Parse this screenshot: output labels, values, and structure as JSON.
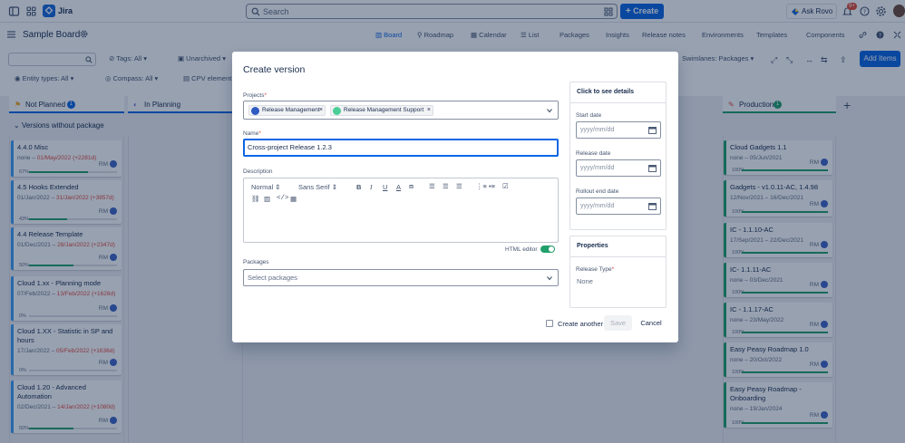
{
  "topnav": {
    "app_name": "Jira",
    "search_placeholder": "Search",
    "create_label": "Create",
    "ask_rovo_label": "Ask Rovo",
    "notifications_badge": "9+"
  },
  "board": {
    "title": "Sample Board",
    "tabs": [
      "Board",
      "Roadmap",
      "Calendar",
      "List",
      "Packages",
      "Insights",
      "Release notes",
      "Environments",
      "Templates",
      "Components"
    ],
    "active_tab": "Board"
  },
  "filters": {
    "tags": "Tags: All",
    "unarchived": "Unarchived",
    "entity_types": "Entity types: All",
    "compass": "Compass: All",
    "cpv": "CPV element",
    "swimlanes": "Swimlanes: Packages",
    "add_items": "Add Items"
  },
  "columns": {
    "not_planned": "Not Planned",
    "in_planning": "In Planning",
    "production": "Production",
    "not_planned_count": "1",
    "production_count": "1"
  },
  "swimlane_label": "Versions without package",
  "left_cards": [
    {
      "title": "4.4.0 Misc",
      "dates": "none – ",
      "late_date": "01/May/2022",
      "late": "(+2281d)",
      "pct": "67%",
      "fill": 0.67,
      "owner": "RM"
    },
    {
      "title": "4.5 Hooks Extended",
      "dates": "01/Jan/2022 – ",
      "late_date": "31/Jan/2022",
      "late": "(+3857d)",
      "pct": "43%",
      "fill": 0.43,
      "owner": "RM"
    },
    {
      "title": "4.4 Release Template",
      "dates": "01/Dec/2021 – ",
      "late_date": "28/Jan/2022",
      "late": "(+2347d)",
      "pct": "50%",
      "fill": 0.5,
      "owner": "RM"
    },
    {
      "title": "Cloud 1.xx - Planning mode",
      "dates": "07/Feb/2022 – ",
      "late_date": "13/Feb/2022",
      "late": "(+1628d)",
      "pct": "0%",
      "fill": 0.0,
      "owner": "RM"
    },
    {
      "title": "Cloud 1.XX - Statistic in SP and hours",
      "dates": "17/Jan/2022 – ",
      "late_date": "05/Feb/2022",
      "late": "(+1636d)",
      "pct": "0%",
      "fill": 0.0,
      "owner": "RM"
    },
    {
      "title": "Cloud 1.20 - Advanced Automation",
      "dates": "02/Dec/2021 – ",
      "late_date": "14/Jan/2022",
      "late": "(+1080d)",
      "pct": "50%",
      "fill": 0.5,
      "owner": "RM"
    }
  ],
  "right_cards": [
    {
      "title": "Cloud Gadgets 1.1",
      "dates": "none – 05/Jun/2021",
      "pct": "100%",
      "owner": "RM"
    },
    {
      "title": "Gadgets - v1.0.11-AC, 1.4.98",
      "dates": "12/Nov/2021 – 16/Dec/2021",
      "pct": "100%",
      "owner": "RM"
    },
    {
      "title": "IC - 1.1.10-AC",
      "dates": "17/Sep/2021 – 22/Dec/2021",
      "pct": "100%",
      "owner": "RM"
    },
    {
      "title": "IC- 1.1.11-AC",
      "dates": "none – 03/Dec/2021",
      "pct": "100%",
      "owner": "RM"
    },
    {
      "title": "IC - 1.1.17-AC",
      "dates": "none – 23/May/2022",
      "pct": "100%",
      "owner": "RM"
    },
    {
      "title": "Easy Peasy Roadmap 1.0",
      "dates": "none – 20/Oct/2022",
      "pct": "100%",
      "owner": "RM"
    },
    {
      "title": "Easy Peasy Roadmap - Onboarding",
      "dates": "none – 19/Jan/2024",
      "pct": "100%",
      "owner": "RM"
    }
  ],
  "modal": {
    "title": "Create version",
    "projects_label": "Projects",
    "projects": [
      "Release Management",
      "Release Management Support"
    ],
    "name_label": "Name",
    "name_value": "Cross-project Release 1.2.3",
    "description_label": "Description",
    "toolbar_format": "Normal",
    "toolbar_font": "Sans Serif",
    "html_editor_label": "HTML editor",
    "packages_label": "Packages",
    "packages_placeholder": "Select packages",
    "details_title": "Click to see details",
    "start_date_label": "Start date",
    "release_date_label": "Release date",
    "rollout_end_date_label": "Rollout end date",
    "date_placeholder": "yyyy/mm/dd",
    "properties_title": "Properties",
    "release_type_label": "Release Type",
    "release_type_value": "None",
    "create_another_label": "Create another",
    "save_label": "Save",
    "cancel_label": "Cancel"
  },
  "colors": {
    "primary": "#0c66e4",
    "danger": "#e2483d",
    "success": "#22a06b"
  }
}
